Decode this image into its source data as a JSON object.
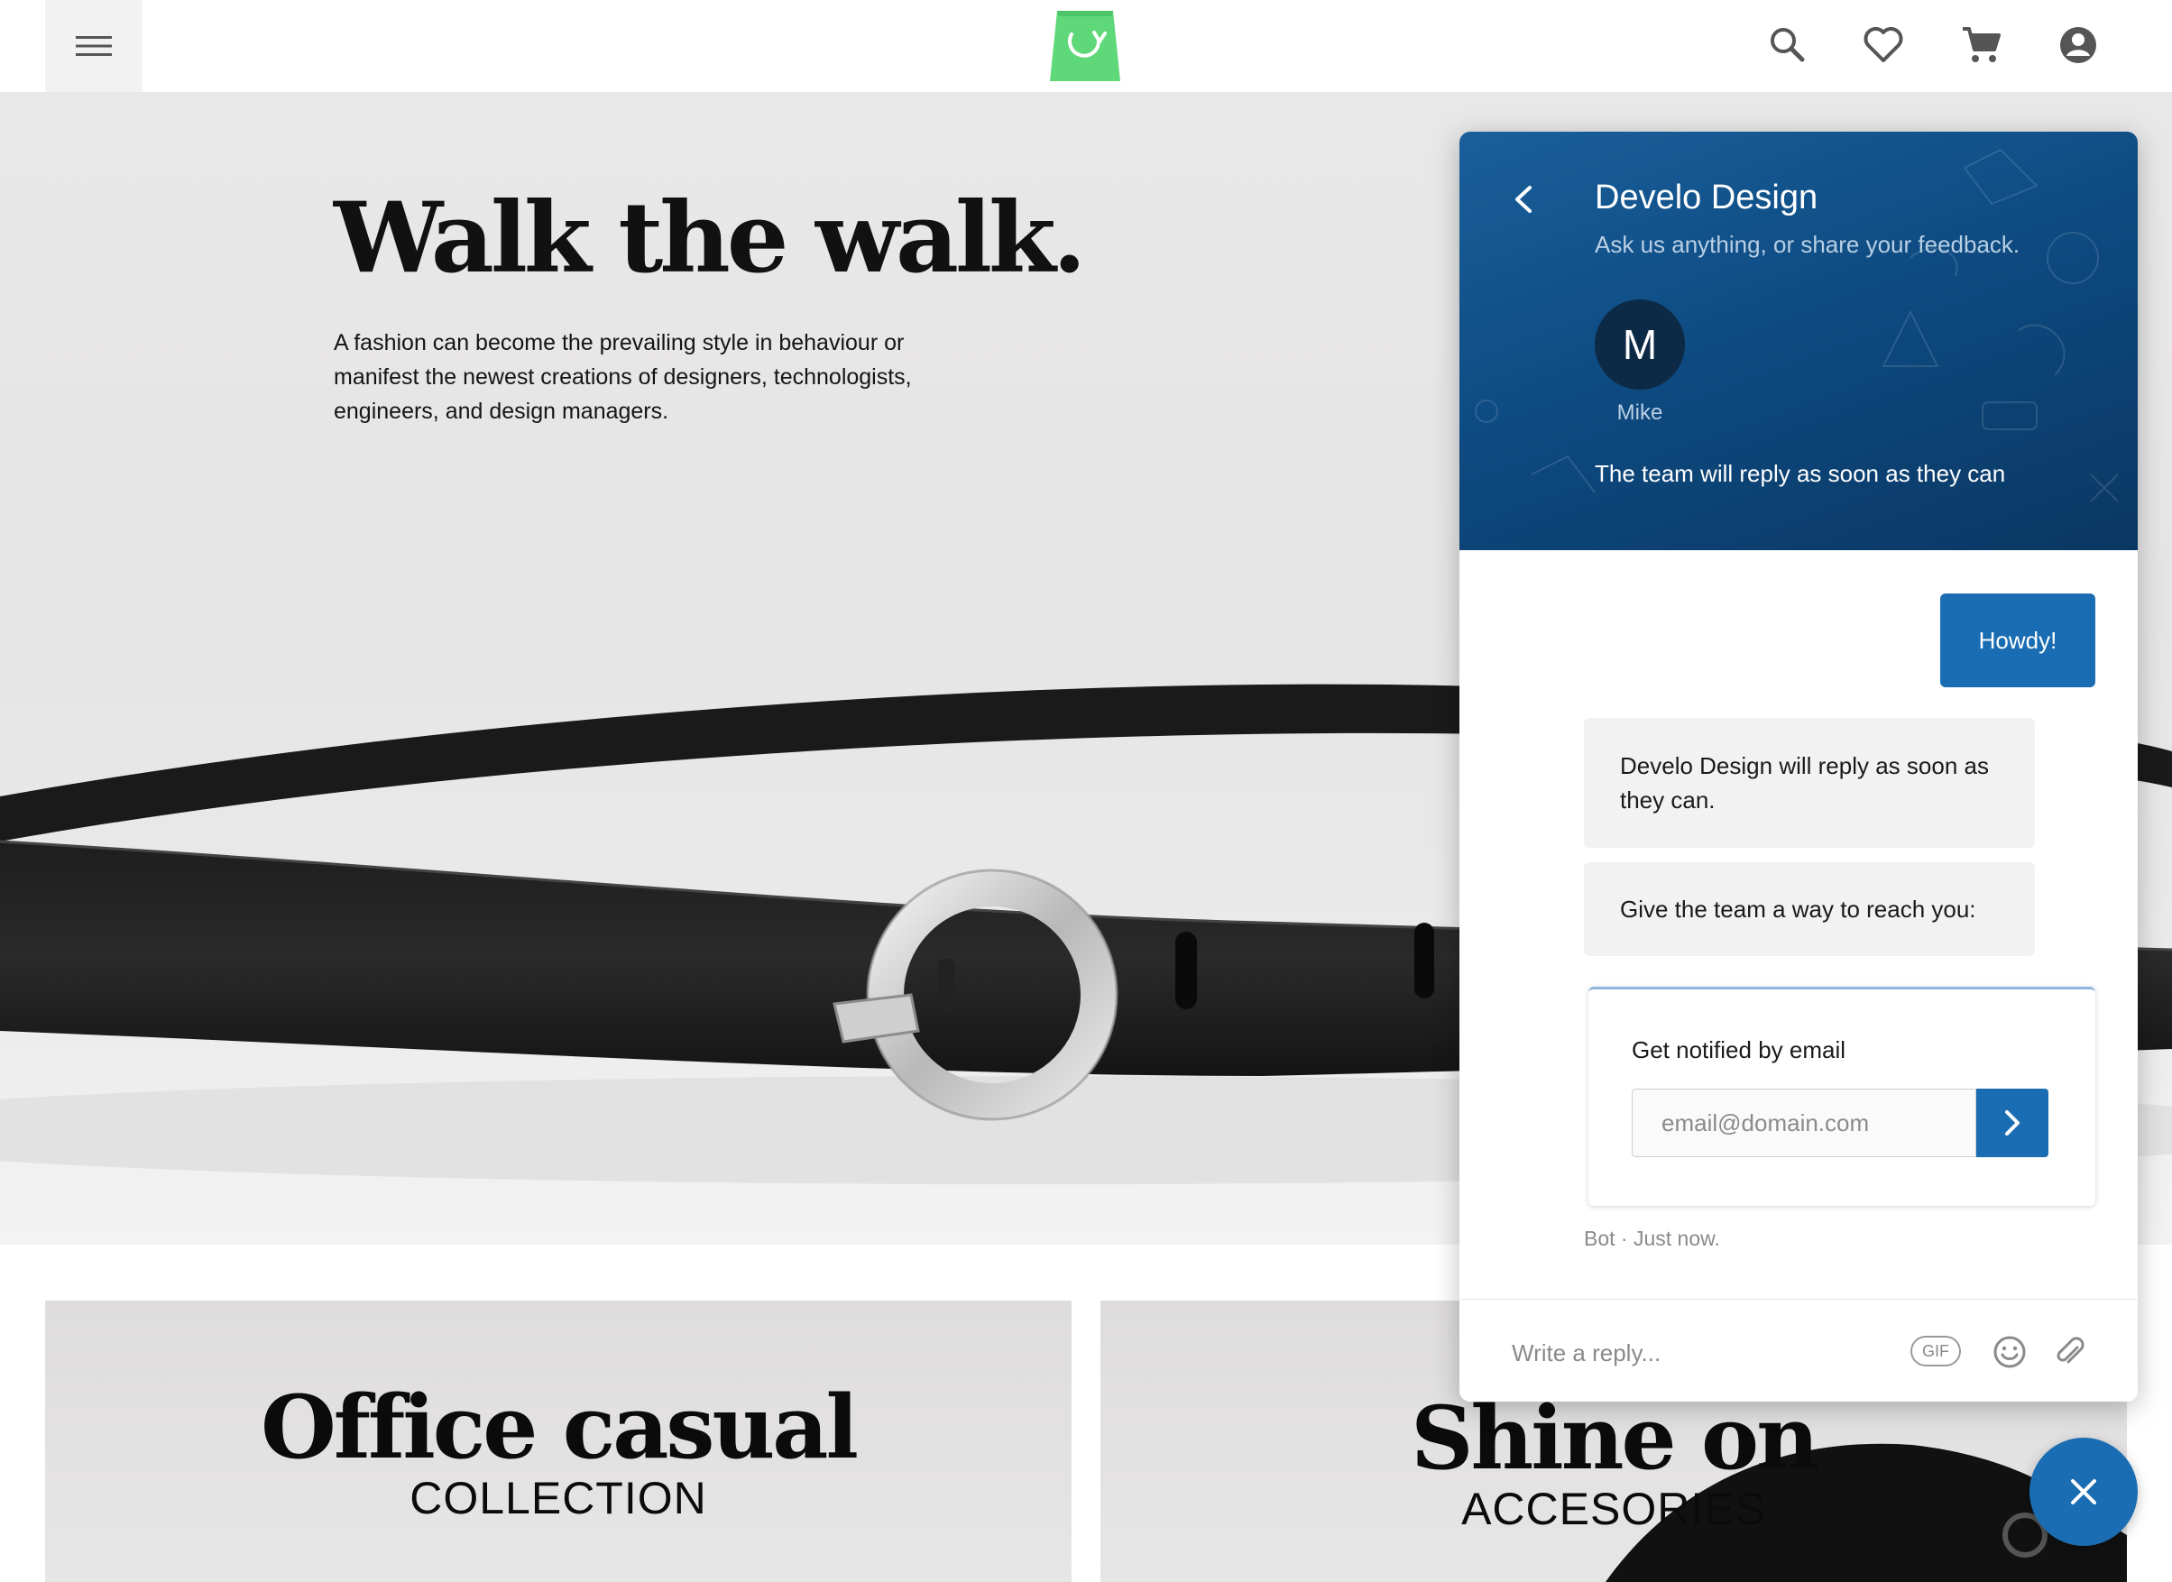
{
  "topbar": {
    "menu_icon": "hamburger-menu-icon",
    "logo": "shopping-bag-logo",
    "icons": [
      "search-icon",
      "heart-icon",
      "cart-icon",
      "account-icon"
    ]
  },
  "hero": {
    "title": "Walk the walk.",
    "text": "A fashion can become the prevailing style in behaviour or manifest the newest creations of designers, technologists, engineers, and design managers."
  },
  "cards": [
    {
      "title": "Office casual",
      "subtitle": "COLLECTION"
    },
    {
      "title": "Shine on",
      "subtitle": "ACCESORIES"
    }
  ],
  "chat": {
    "team_name": "Develo Design",
    "tagline": "Ask us anything, or share your feedback.",
    "avatar_initial": "M",
    "avatar_name": "Mike",
    "reply_note": "The team will reply as soon as they can",
    "messages": {
      "user": "Howdy!",
      "bot1": "Develo Design will reply as soon as they can.",
      "bot2": "Give the team a way to reach you:"
    },
    "email_card": {
      "label": "Get notified by email",
      "placeholder": "email@domain.com"
    },
    "meta": "Bot · Just now.",
    "composer": {
      "placeholder": "Write a reply...",
      "gif_label": "GIF"
    }
  },
  "colors": {
    "accent": "#1a6db2",
    "header_dark": "#0a3762",
    "logo_green": "#5fd87a"
  }
}
